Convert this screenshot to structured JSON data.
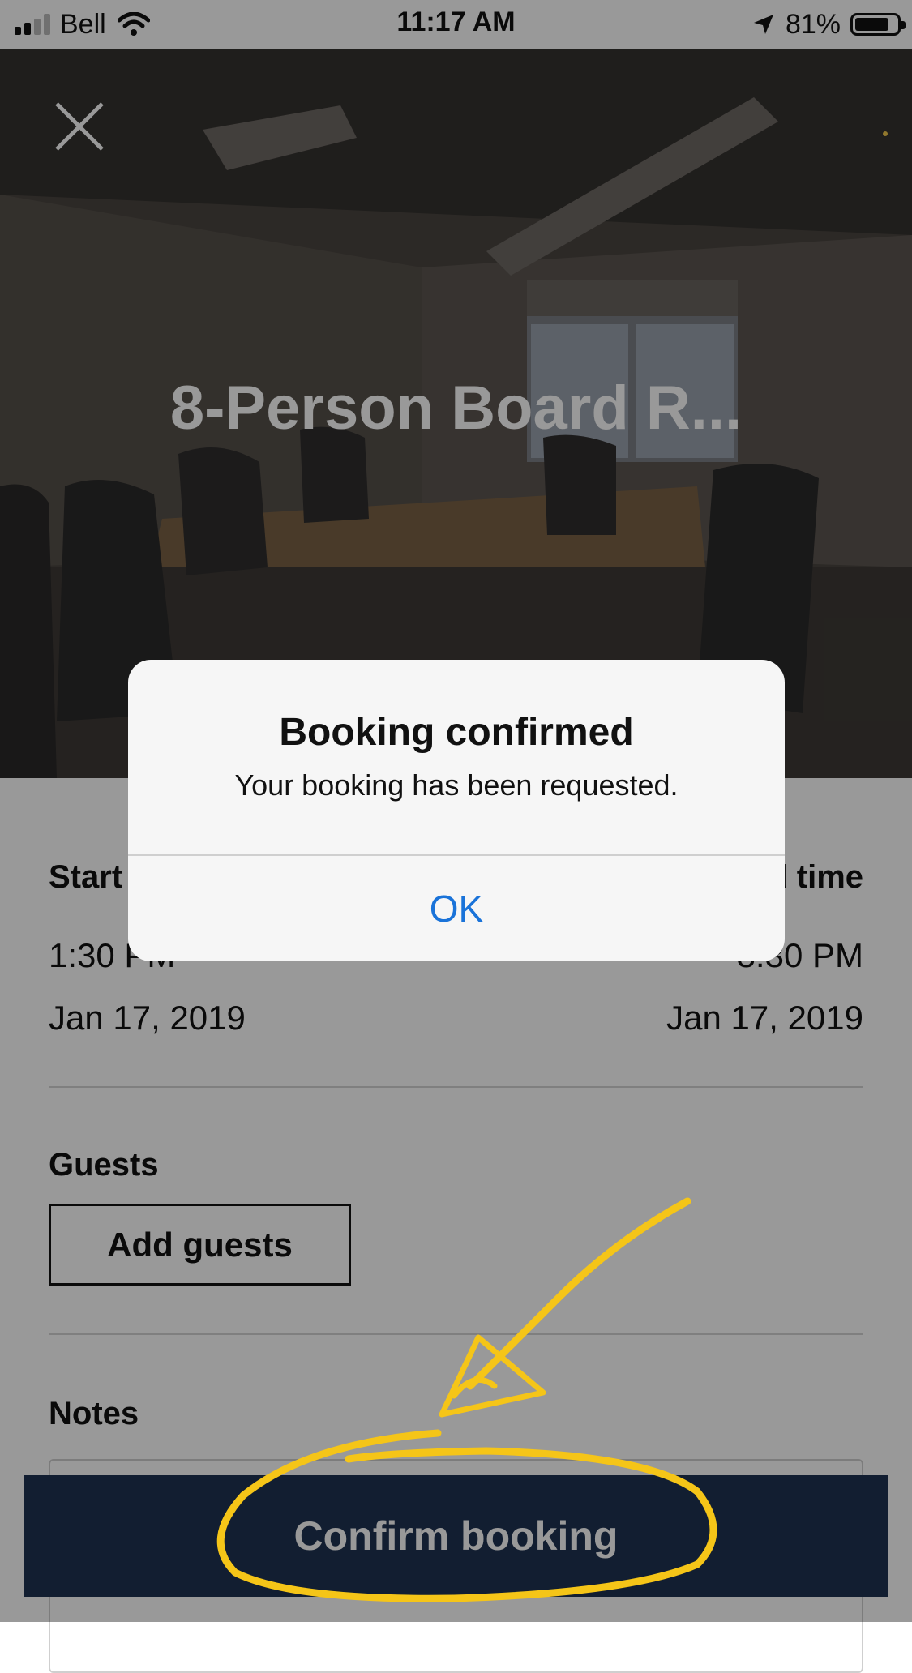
{
  "status_bar": {
    "carrier": "Bell",
    "time": "11:17 AM",
    "battery": "81%",
    "battery_level": 0.81,
    "icons": [
      "signal-icon",
      "wifi-icon",
      "location-arrow-icon",
      "battery-icon"
    ]
  },
  "hero": {
    "title": "8-Person Board R...",
    "close_icon": "close-icon"
  },
  "booking": {
    "start_label": "Start time",
    "end_label": "End time",
    "start_time": "1:30 PM",
    "end_time": "3:30 PM",
    "start_date": "Jan 17, 2019",
    "end_date": "Jan 17, 2019"
  },
  "guests": {
    "label": "Guests",
    "button": "Add guests"
  },
  "notes": {
    "label": "Notes"
  },
  "footer": {
    "confirm_button": "Confirm booking"
  },
  "alert": {
    "title": "Booking confirmed",
    "message": "Your booking has been requested.",
    "ok": "OK"
  },
  "colors": {
    "accent_link": "#1a73d9",
    "button_navy": "#1f3352",
    "annotation_yellow": "#f5c518"
  }
}
